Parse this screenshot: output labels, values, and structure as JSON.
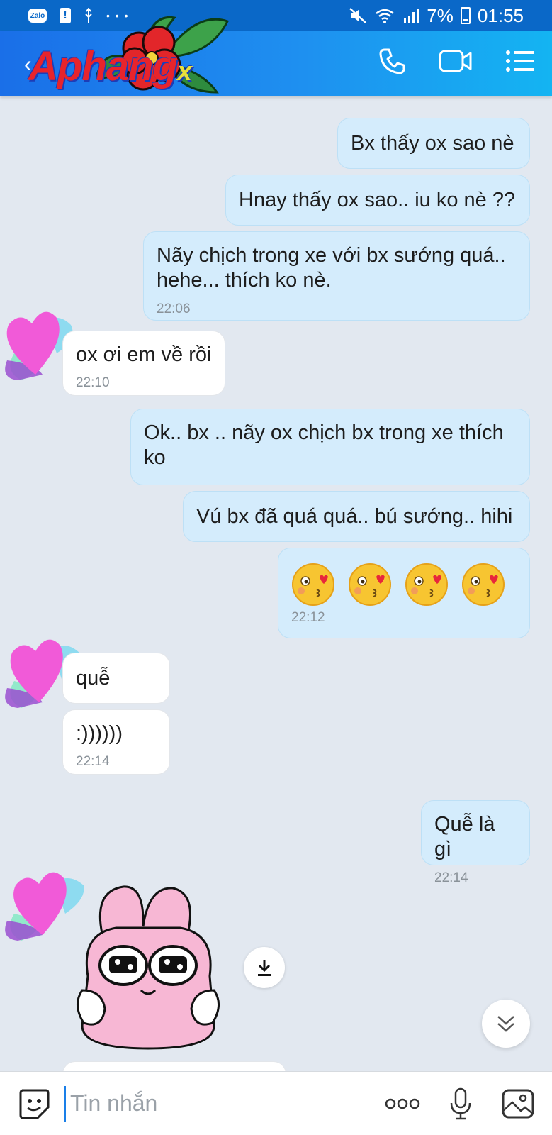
{
  "status_bar": {
    "app_badge": "Zalo",
    "warning_badge": "!",
    "more_dots": "• • •",
    "battery": "7%",
    "time": "01:55"
  },
  "header": {
    "logo_text": "Aphang",
    "logo_suffix": "x"
  },
  "messages": [
    {
      "dir": "out",
      "text": "Bx thấy ox sao nè",
      "time": ""
    },
    {
      "dir": "out",
      "text": "Hnay thấy ox sao.. iu ko nè ??",
      "time": ""
    },
    {
      "dir": "out",
      "text": "Nãy chịch trong xe với bx sướng quá.. hehe... thích ko nè.",
      "time": "22:06"
    },
    {
      "dir": "in",
      "text": "ox ơi em về rồi",
      "time": "22:10"
    },
    {
      "dir": "out",
      "text": "Ok.. bx .. nãy ox chịch bx trong xe thích ko",
      "time": ""
    },
    {
      "dir": "out",
      "text": "Vú bx đã quá quá.. bú sướng.. hihi",
      "time": ""
    },
    {
      "dir": "out",
      "text": "😘😘😘😘",
      "time": "22:12"
    },
    {
      "dir": "in",
      "text": "quễ",
      "time": ""
    },
    {
      "dir": "in",
      "text": ":))))))",
      "time": "22:14"
    },
    {
      "dir": "out",
      "text": "Quễ là gì",
      "time": "22:14"
    }
  ],
  "input": {
    "placeholder": "Tin nhắn"
  },
  "colors": {
    "header_start": "#1a6fe8",
    "header_end": "#14b4f2",
    "outgoing_bubble": "#d4ecfc",
    "incoming_bubble": "#ffffff",
    "chat_background": "#e2e8f0"
  },
  "icons": {
    "call": "phone-icon",
    "video": "video-call-icon",
    "menu": "list-menu-icon",
    "download": "download-icon",
    "scroll": "chevron-double-down-icon",
    "sticker": "sticker-face-icon",
    "more": "more-dots-icon",
    "mic": "microphone-icon",
    "image": "image-icon"
  }
}
